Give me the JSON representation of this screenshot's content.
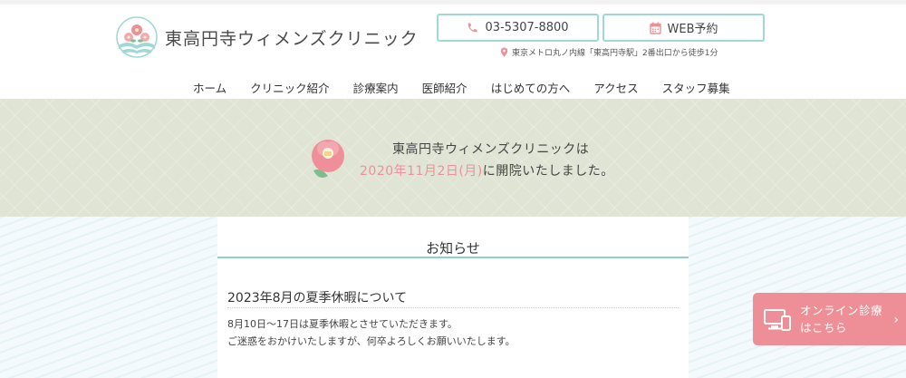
{
  "header": {
    "clinic_name": "東高円寺ウィメンズクリニック",
    "phone_label": "03-5307-8800",
    "web_reserve_label": "WEB予約",
    "access_text": "東京メトロ丸ノ内線「東高円寺駅」2番出口から徒歩1分"
  },
  "nav": {
    "items": [
      {
        "label": "ホーム"
      },
      {
        "label": "クリニック紹介"
      },
      {
        "label": "診療案内"
      },
      {
        "label": "医師紹介"
      },
      {
        "label": "はじめての方へ"
      },
      {
        "label": "アクセス"
      },
      {
        "label": "スタッフ募集"
      }
    ]
  },
  "banner": {
    "line1": "東高円寺ウィメンズクリニックは",
    "date": "2020年11月2日(月)",
    "line2_rest": "に開院いたしました。"
  },
  "notice": {
    "heading": "お知らせ",
    "post_title": "2023年8月の夏季休暇について",
    "post_line1": "8月10日～17日は夏季休暇とさせていただきます。",
    "post_line2": "ご迷惑をおかけいたしますが、何卒よろしくお願いいたします。"
  },
  "online": {
    "line1": "オンライン診療",
    "line2": "はこちら",
    "chevron": "›"
  },
  "colors": {
    "accent_teal": "#9fd8d6",
    "accent_pink": "#ee8f98",
    "banner_bg": "#dfe4d4"
  },
  "icons": {
    "phone": "phone-icon",
    "calendar": "calendar-icon",
    "location": "location-pin-icon",
    "logo": "camellia-logo-icon",
    "monitor": "monitor-phone-icon"
  }
}
